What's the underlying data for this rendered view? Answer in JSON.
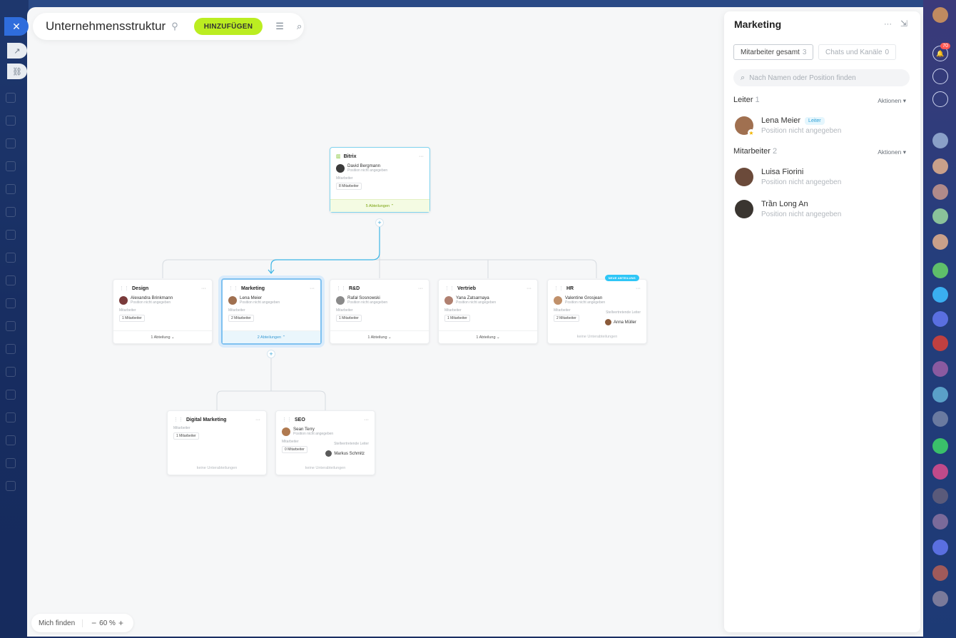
{
  "toolbar": {
    "title": "Unternehmensstruktur",
    "add_label": "HINZUFÜGEN"
  },
  "zoom": {
    "find_label": "Mich finden",
    "minus": "−",
    "value": "60 %",
    "plus": "+"
  },
  "org": {
    "root": {
      "name": "Bitrix",
      "head_name": "David Bergmann",
      "head_position": "Position nicht angegeben",
      "staff_label": "Mitarbeiter",
      "staff_count": "8 Mitarbeiter",
      "footer": "5 Abteilungen"
    },
    "departments": [
      {
        "name": "Design",
        "head_name": "Alexandra Brinkmann",
        "head_position": "Position nicht angegeben",
        "staff_label": "Mitarbeiter",
        "staff_count": "1 Mitarbeiter",
        "footer": "1 Abteilung",
        "avatar_color": "#7a3b3b"
      },
      {
        "name": "Marketing",
        "head_name": "Lena Meier",
        "head_position": "Position nicht angegeben",
        "staff_label": "Mitarbeiter",
        "staff_count": "2 Mitarbeiter",
        "footer": "2 Abteilungen",
        "avatar_color": "#a07050"
      },
      {
        "name": "R&D",
        "head_name": "Rafał Sosnowski",
        "head_position": "Position nicht angegeben",
        "staff_label": "Mitarbeiter",
        "staff_count": "1 Mitarbeiter",
        "footer": "1 Abteilung",
        "avatar_color": "#8a8a8a"
      },
      {
        "name": "Vertrieb",
        "head_name": "Yana Zatsarnaya",
        "head_position": "Position nicht angegeben",
        "staff_label": "Mitarbeiter",
        "staff_count": "1 Mitarbeiter",
        "footer": "1 Abteilung",
        "avatar_color": "#b08070"
      },
      {
        "name": "HR",
        "head_name": "Valentine Grosjean",
        "head_position": "Position nicht angegeben",
        "staff_label": "Mitarbeiter",
        "staff_count": "2 Mitarbeiter",
        "deputy_label": "Stellvertretende Leiter",
        "deputy_name": "Anna Müller",
        "footer": "keine Unterabteilungen",
        "badge": "NEUE ABTEILUNG",
        "avatar_color": "#c0906a"
      }
    ],
    "sub_departments": [
      {
        "name": "Digital Marketing",
        "staff_label": "Mitarbeiter",
        "staff_count": "1 Mitarbeiter",
        "footer": "keine Unterabteilungen"
      },
      {
        "name": "SEO",
        "head_name": "Sean Terry",
        "head_position": "Position nicht angegeben",
        "staff_label": "Mitarbeiter",
        "staff_count": "0 Mitarbeiter",
        "deputy_label": "Stellvertretende Leiter",
        "deputy_name": "Markus Schmitz",
        "footer": "keine Unterabteilungen",
        "avatar_color": "#b07a50"
      }
    ]
  },
  "panel": {
    "title": "Marketing",
    "tabs": [
      {
        "label": "Mitarbeiter gesamt",
        "count": "3"
      },
      {
        "label": "Chats und Kanäle",
        "count": "0"
      }
    ],
    "search_placeholder": "Nach Namen oder Position finden",
    "heads_section": {
      "label": "Leiter",
      "count": "1",
      "action": "Aktionen"
    },
    "heads": [
      {
        "name": "Lena Meier",
        "badge": "Leiter",
        "position": "Position nicht angegeben",
        "avatar_color": "#a07050"
      }
    ],
    "staff_section": {
      "label": "Mitarbeiter",
      "count": "2",
      "action": "Aktionen"
    },
    "staff": [
      {
        "name": "Luisa Fiorini",
        "position": "Position nicht angegeben",
        "avatar_color": "#6b4a3a"
      },
      {
        "name": "Trần Long An",
        "position": "Position nicht angegeben",
        "avatar_color": "#3a3530"
      }
    ]
  },
  "rail": {
    "notification_count": "70"
  },
  "colors": {
    "accent_green": "#bbed21",
    "accent_blue": "#2fc6f6",
    "close_blue": "#2f6ddc"
  }
}
